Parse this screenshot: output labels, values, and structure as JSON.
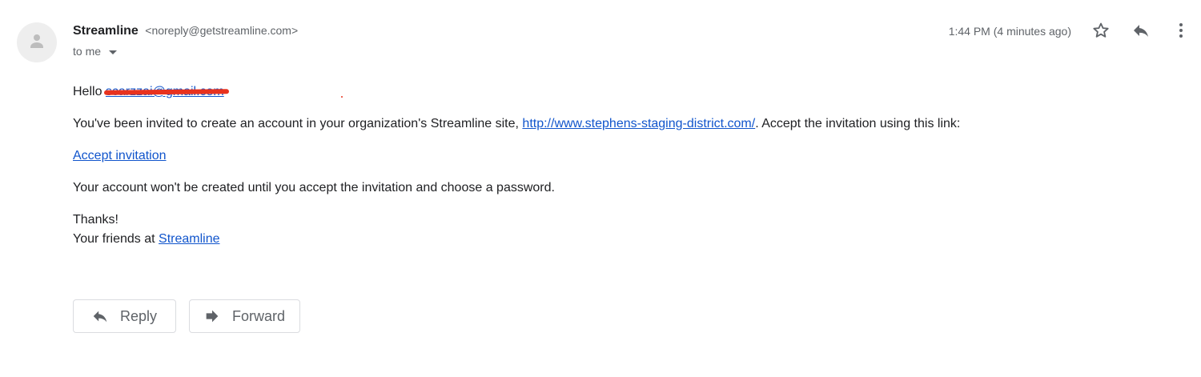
{
  "header": {
    "sender_name": "Streamline",
    "sender_email": "<noreply@getstreamline.com>",
    "to_label": "to me",
    "timestamp": "1:44 PM (4 minutes ago)"
  },
  "body": {
    "greeting": "Hello",
    "redacted_email": "scarzzai@gmail.com",
    "invite_prefix": "You've been invited to create an account in your organization's Streamline site, ",
    "site_link": "http://www.stephens-staging-district.com/",
    "invite_suffix": ". Accept the invitation using this link:",
    "accept_link": "Accept invitation",
    "account_note": "Your account won't be created until you accept the invitation and choose a password.",
    "thanks": "Thanks!",
    "friends_prefix": "Your friends at ",
    "friends_link": "Streamline"
  },
  "actions": {
    "reply_label": "Reply",
    "forward_label": "Forward"
  },
  "icons": {
    "avatar": "person-icon",
    "star": "star-icon",
    "reply": "reply-icon",
    "more": "more-vert-icon",
    "caret": "chevron-down-icon",
    "forward": "forward-icon"
  },
  "colors": {
    "link": "#1155cc",
    "muted": "#5f6368",
    "redaction": "#e8321e",
    "border": "#dadce0"
  }
}
